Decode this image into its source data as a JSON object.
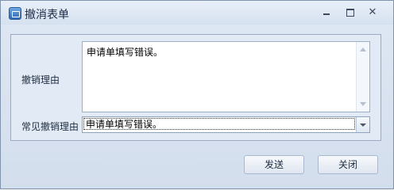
{
  "window": {
    "title": "撤消表单",
    "controls": {
      "minimize": "minimize-icon",
      "maximize": "maximize-icon",
      "close": "✕"
    }
  },
  "form": {
    "reason_label": "撤销理由",
    "reason_text": "申请单填写错误。",
    "common_reason_label": "常见撤销理由",
    "common_reason_value": "申请单填写错误。"
  },
  "buttons": {
    "send": "发送",
    "close": "关闭"
  },
  "colors": {
    "title_bar": "#dfe8f4",
    "panel": "#e2eaf5",
    "border": "#9aaac2"
  }
}
